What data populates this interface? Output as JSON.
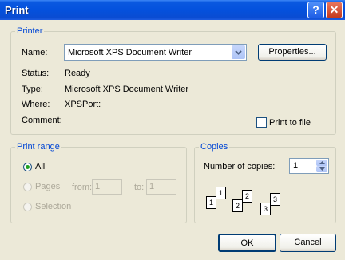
{
  "window": {
    "title": "Print",
    "help_glyph": "?",
    "close_glyph": "✕"
  },
  "printer": {
    "legend": "Printer",
    "name_label": "Name:",
    "name_value": "Microsoft XPS Document Writer",
    "properties_button": "Properties...",
    "status_label": "Status:",
    "status_value": "Ready",
    "type_label": "Type:",
    "type_value": "Microsoft XPS Document Writer",
    "where_label": "Where:",
    "where_value": "XPSPort:",
    "comment_label": "Comment:",
    "comment_value": "",
    "print_to_file_label": "Print to file",
    "print_to_file_checked": false
  },
  "print_range": {
    "legend": "Print range",
    "all_label": "All",
    "pages_label": "Pages",
    "from_label": "from:",
    "from_value": "1",
    "to_label": "to:",
    "to_value": "1",
    "selection_label": "Selection",
    "selected": "All"
  },
  "copies": {
    "legend": "Copies",
    "number_label": "Number of copies:",
    "number_value": "1",
    "collate_pages": [
      "1",
      "1",
      "2",
      "2",
      "3",
      "3"
    ]
  },
  "buttons": {
    "ok": "OK",
    "cancel": "Cancel"
  },
  "colors": {
    "title_bar": "#0451dd",
    "group_legend": "#0046d5",
    "dialog_bg": "#ece9d8"
  }
}
